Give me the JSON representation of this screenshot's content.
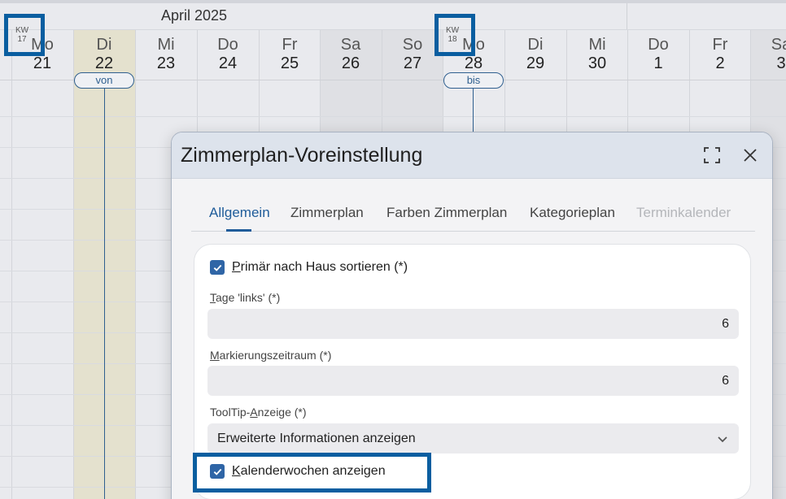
{
  "calendar": {
    "month_label": "April 2025",
    "days": [
      {
        "name": "Mo",
        "num": "21"
      },
      {
        "name": "Di",
        "num": "22"
      },
      {
        "name": "Mi",
        "num": "23"
      },
      {
        "name": "Do",
        "num": "24"
      },
      {
        "name": "Fr",
        "num": "25"
      },
      {
        "name": "Sa",
        "num": "26"
      },
      {
        "name": "So",
        "num": "27"
      },
      {
        "name": "Mo",
        "num": "28"
      },
      {
        "name": "Di",
        "num": "29"
      },
      {
        "name": "Mi",
        "num": "30"
      },
      {
        "name": "Do",
        "num": "1"
      },
      {
        "name": "Fr",
        "num": "2"
      },
      {
        "name": "Sa",
        "num": "3"
      }
    ],
    "kw_17": {
      "label": "KW",
      "week": "17"
    },
    "kw_18": {
      "label": "KW",
      "week": "18"
    },
    "range_start": "von",
    "range_end": "bis"
  },
  "dialog": {
    "title": "Zimmerplan-Voreinstellung",
    "tabs": [
      {
        "label": "Allgemein",
        "state": "active"
      },
      {
        "label": "Zimmerplan",
        "state": "normal"
      },
      {
        "label": "Farben Zimmerplan",
        "state": "normal"
      },
      {
        "label": "Kategorieplan",
        "state": "normal"
      },
      {
        "label": "Terminkalender",
        "state": "disabled"
      }
    ],
    "fields": {
      "sort_by_house": {
        "accesskey": "P",
        "rest": "rimär nach Haus sortieren (*)",
        "checked": true
      },
      "days_left": {
        "accesskey": "T",
        "rest": "age 'links' (*)",
        "value": "6"
      },
      "mark_period": {
        "accesskey": "M",
        "rest": "arkierungszeitraum (*)",
        "value": "6"
      },
      "tooltip": {
        "prefix": "ToolTip-",
        "accesskey": "A",
        "rest": "nzeige (*)",
        "value": "Erweiterte Informationen anzeigen"
      },
      "show_weeks": {
        "accesskey": "K",
        "rest": "alenderwochen anzeigen",
        "checked": true
      }
    }
  },
  "colors": {
    "accent": "#1f5c9a",
    "highlight_border": "#0a5ea0",
    "checkbox": "#2f65a6",
    "today_column": "#e4e1ce",
    "weekend_column": "#dfe0e4"
  }
}
